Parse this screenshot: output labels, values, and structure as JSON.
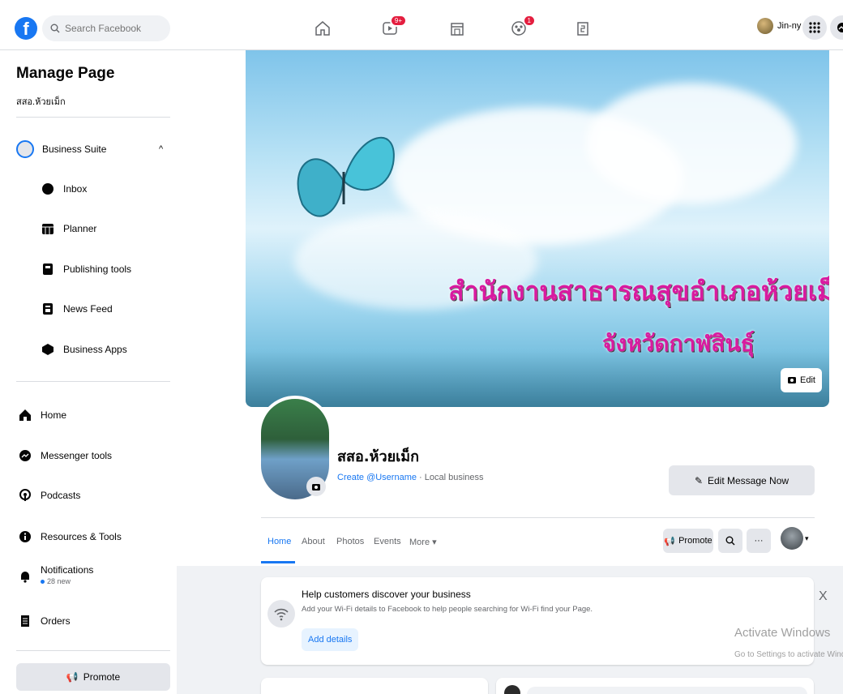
{
  "topbar": {
    "logo": "f",
    "search_placeholder": "Search Facebook",
    "nav_icons": [
      "home-icon",
      "watch-icon",
      "marketplace-icon",
      "groups-icon",
      "pages-icon"
    ],
    "watch_badge": "9+",
    "groups_badge": "1",
    "user_name": "Jin-ny"
  },
  "sidebar": {
    "title": "Manage Page",
    "page_name": "สสอ.ห้วยเม็ก",
    "business_suite": "Business Suite",
    "suite_items": [
      "Inbox",
      "Planner",
      "Publishing tools",
      "News Feed",
      "Business Apps"
    ],
    "menu_items": [
      "Home",
      "Messenger tools",
      "Podcasts",
      "Resources & Tools",
      "Notifications",
      "Orders"
    ],
    "notifications_note": "28 new",
    "promote_label": "Promote"
  },
  "cover": {
    "line1": "สำนักงานสาธารณสุขอำเภอห้วยเม็ก",
    "line2": "จังหวัดกาฬสินธุ์",
    "edit_label": "Edit"
  },
  "page": {
    "name": "สสอ.ห้วยเม็ก",
    "username_link": "Create @Username",
    "category": " · Local business",
    "edit_message": "Edit Message Now"
  },
  "tabs": [
    "Home",
    "About",
    "Photos",
    "Events",
    "More ▾"
  ],
  "actions": {
    "promote": "Promote",
    "more": "···"
  },
  "help_card": {
    "title": "Help customers discover your business",
    "description": "Add your Wi-Fi details to Facebook to help people searching for Wi-Fi find your Page.",
    "button": "Add details",
    "close": "X"
  },
  "watermark": {
    "line1": "Activate Windows",
    "line2": "Go to Settings to activate Windows."
  },
  "colors": {
    "accent": "#1877f2",
    "badge": "#e41e3f",
    "cover_text": "#d81aa0"
  }
}
